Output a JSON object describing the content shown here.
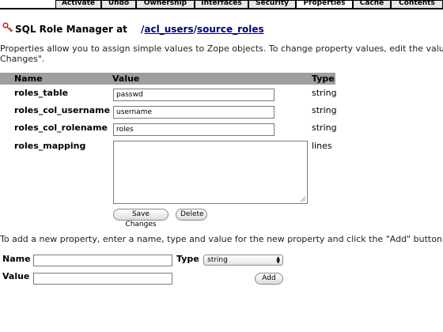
{
  "tabs": [
    {
      "label": "Activate"
    },
    {
      "label": "Undo"
    },
    {
      "label": "Ownership"
    },
    {
      "label": "Interfaces"
    },
    {
      "label": "Security"
    },
    {
      "label": "Properties"
    },
    {
      "label": "Cache"
    },
    {
      "label": "Contents"
    }
  ],
  "active_tab": "Properties",
  "header": {
    "type_label": "SQL Role Manager at",
    "path_part1": "acl_users",
    "path_part2": "source_roles",
    "slash": "/"
  },
  "intro_line1": "Properties allow you to assign simple values to Zope objects. To change property values, edit the valu",
  "intro_line2": "Changes\".",
  "table": {
    "col_name": "Name",
    "col_value": "Value",
    "col_type": "Type",
    "rows": [
      {
        "name": "roles_table",
        "value": "passwd",
        "type": "string"
      },
      {
        "name": "roles_col_username",
        "value": "username",
        "type": "string"
      },
      {
        "name": "roles_col_rolename",
        "value": "roles",
        "type": "string"
      },
      {
        "name": "roles_mapping",
        "value": "",
        "type": "lines"
      }
    ]
  },
  "buttons": {
    "save": "Save Changes",
    "delete": "Delete",
    "add": "Add"
  },
  "add_intro": "To add a new property, enter a name, type and value for the new property and click the \"Add\" button.",
  "new_property": {
    "name_label": "Name",
    "type_label": "Type",
    "value_label": "Value",
    "type_selected": "string"
  }
}
